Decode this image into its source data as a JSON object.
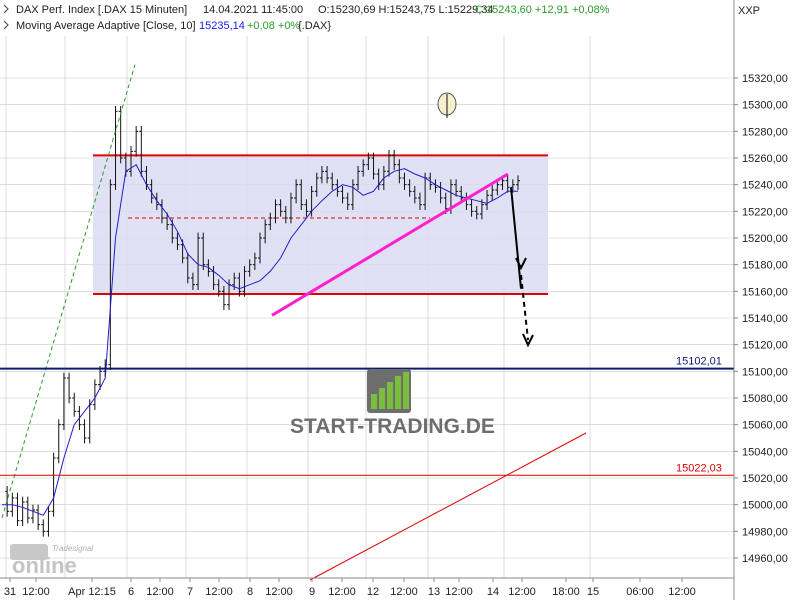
{
  "header": {
    "instrument": "DAX Perf. Index [.DAX  15 Minuten]",
    "datetime": "14.04.2021 11:45:00",
    "ohl": "O:15230,69 H:15243,75 L:15229,34",
    "close_change": "C:15243,60 +12,91 +0,08%",
    "indicator": "Moving Average Adaptive [Close, 10]",
    "indicator_value": "15235,14",
    "indicator_change": "+0,08 +0%",
    "indicator_symbol": "{.DAX}",
    "exchange": "XXP"
  },
  "watermark": {
    "brand": "START-TRADING.DE"
  },
  "logo": {
    "top": "Tradesignal",
    "main": "online"
  },
  "colors": {
    "up": "#2a9d2a",
    "indicator_blue": "#1a1aff",
    "support_resistance": "#e00000",
    "level_line": "#0a1a6e",
    "trendline": "#ff20d0",
    "range_fill": "#dcdcf5",
    "ma_line": "#1e1ecc",
    "price_bar": "#111111"
  },
  "chart_data": {
    "type": "line",
    "title": "",
    "ylim": [
      14940,
      15340
    ],
    "y_ticks": [
      14960,
      14980,
      15000,
      15020,
      15040,
      15060,
      15080,
      15100,
      15120,
      15140,
      15160,
      15180,
      15200,
      15220,
      15240,
      15260,
      15280,
      15300,
      15320
    ],
    "y_tick_labels": [
      "14960,00",
      "14980,00",
      "15000,00",
      "15020,00",
      "15040,00",
      "15060,00",
      "15080,00",
      "15100,00",
      "15120,00",
      "15140,00",
      "15160,00",
      "15180,00",
      "15200,00",
      "15220,00",
      "15240,00",
      "15260,00",
      "15280,00",
      "15300,00",
      "15320,00"
    ],
    "x_tick_labels": [
      "31",
      "12:00",
      "Apr 12:15",
      "6",
      "12:00",
      "7",
      "12:00",
      "8",
      "12:00",
      "9",
      "12:00",
      "12",
      "12:00",
      "13",
      "12:00",
      "14",
      "12:00",
      "18:00",
      "15",
      "06:00",
      "12:00"
    ],
    "grid": true,
    "series": [
      {
        "x": [
          0,
          3,
          6,
          9,
          12,
          15,
          18,
          21,
          24,
          27,
          30,
          33,
          36,
          39,
          42,
          45,
          48,
          51,
          54,
          57,
          60,
          63,
          66,
          69,
          72,
          75,
          78,
          81,
          84,
          87,
          90,
          93,
          96,
          99,
          102,
          105,
          108,
          111,
          114,
          117,
          120,
          123,
          126,
          129,
          132,
          135,
          138,
          141,
          144,
          147,
          150,
          153,
          156,
          159,
          162,
          165,
          168,
          171,
          174,
          177,
          180,
          183,
          186,
          189,
          192,
          195,
          198,
          201,
          204,
          207,
          210,
          213,
          216,
          219,
          222,
          225,
          228,
          231,
          234,
          237,
          240,
          243,
          246,
          249,
          252,
          255,
          258,
          261,
          264,
          267,
          270,
          273,
          276,
          279,
          282,
          285,
          288,
          291,
          294,
          297,
          300
        ],
        "values": [
          15010,
          14995,
          15005,
          14988,
          15002,
          14990,
          14996,
          14985,
          14980,
          14995,
          15035,
          15060,
          15095,
          15080,
          15070,
          15060,
          15050,
          15075,
          15090,
          15100,
          15105,
          15240,
          15295,
          15260,
          15250,
          15265,
          15280,
          15250,
          15240,
          15230,
          15225,
          15215,
          15210,
          15200,
          15195,
          15185,
          15170,
          15165,
          15200,
          15180,
          15175,
          15165,
          15160,
          15150,
          15165,
          15170,
          15160,
          15175,
          15180,
          15185,
          15200,
          15210,
          15215,
          15225,
          15220,
          15215,
          15230,
          15240,
          15225,
          15220,
          15235,
          15245,
          15250,
          15245,
          15240,
          15235,
          15230,
          15225,
          15240,
          15250,
          15255,
          15260,
          15248,
          15240,
          15250,
          15262,
          15255,
          15245,
          15240,
          15235,
          15230,
          15225,
          15245,
          15240,
          15238,
          15230,
          15222,
          15240,
          15235,
          15230,
          15225,
          15220,
          15218,
          15225,
          15232,
          15236,
          15240,
          15243,
          15238,
          15240,
          15243
        ]
      },
      {
        "x": [
          0,
          6,
          12,
          18,
          24,
          30,
          36,
          42,
          48,
          54,
          60,
          66,
          72,
          78,
          84,
          90,
          96,
          102,
          108,
          114,
          120,
          126,
          132,
          138,
          144,
          150,
          156,
          162,
          168,
          174,
          180,
          186,
          192,
          198,
          204,
          210,
          216,
          222,
          228,
          234,
          240,
          246,
          252,
          258,
          264,
          270,
          276,
          282,
          288,
          294,
          300
        ],
        "values": [
          15000,
          15000,
          14998,
          14995,
          14992,
          15005,
          15035,
          15060,
          15070,
          15080,
          15095,
          15200,
          15250,
          15255,
          15240,
          15228,
          15218,
          15205,
          15188,
          15180,
          15178,
          15172,
          15165,
          15162,
          15165,
          15168,
          15175,
          15185,
          15200,
          15210,
          15220,
          15228,
          15235,
          15240,
          15238,
          15232,
          15235,
          15245,
          15250,
          15252,
          15248,
          15245,
          15240,
          15236,
          15232,
          15230,
          15228,
          15226,
          15230,
          15235,
          15235
        ]
      }
    ],
    "annotations": [
      {
        "label": "15102,01",
        "value": 15102.01
      },
      {
        "label": "15022,03",
        "value": 15022.03
      }
    ]
  }
}
